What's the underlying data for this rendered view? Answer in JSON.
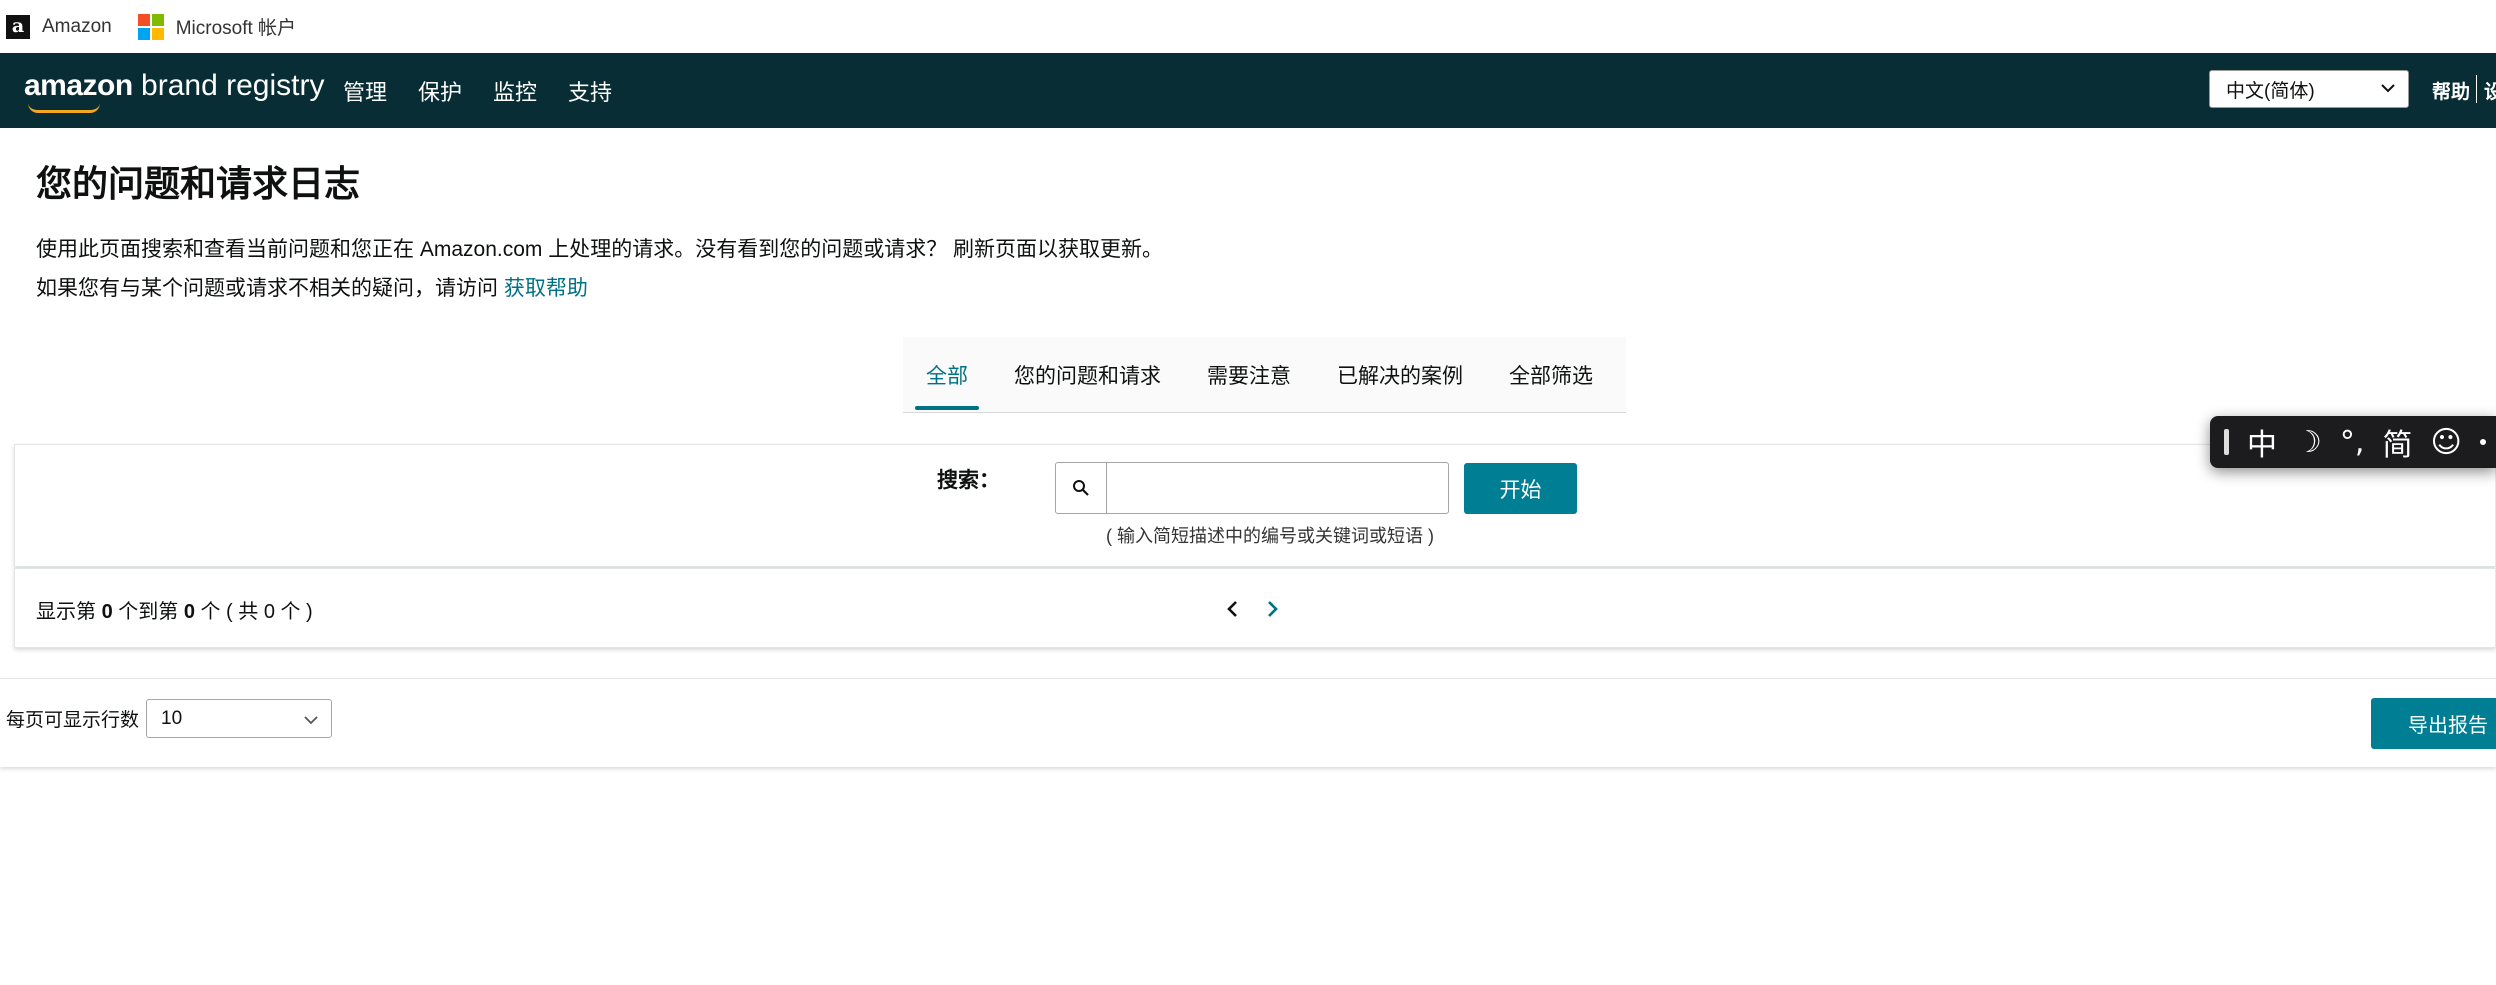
{
  "bookmarks": [
    {
      "label": "Amazon",
      "icon": "amazon-icon"
    },
    {
      "label": "Microsoft 帐户",
      "icon": "microsoft-icon"
    }
  ],
  "nav": {
    "logo_bold": "amazon",
    "logo_rest": " brand registry",
    "items": [
      "管理",
      "保护",
      "监控",
      "支持"
    ],
    "language": "中文(简体)",
    "help": "帮助",
    "settings": "设"
  },
  "page": {
    "title": "您的问题和请求日志",
    "desc1": "使用此页面搜索和查看当前问题和您正在 Amazon.com 上处理的请求。没有看到您的问题或请求？ 刷新页面以获取更新。",
    "desc2": "如果您有与某个问题或请求不相关的疑问，请访问 ",
    "help_link": "获取帮助"
  },
  "tabs": [
    {
      "label": "全部",
      "active": true
    },
    {
      "label": "您的问题和请求",
      "active": false
    },
    {
      "label": "需要注意",
      "active": false
    },
    {
      "label": "已解决的案例",
      "active": false
    },
    {
      "label": "全部筛选",
      "active": false
    }
  ],
  "search": {
    "label": "搜索：",
    "value": "",
    "button": "开始",
    "hint": "( 输入简短描述中的编号或关键词或短语 )"
  },
  "pagination": {
    "prefix": "显示第 ",
    "from": "0",
    "mid": " 个到第 ",
    "to": "0",
    "suffix": " 个 ( 共 0 个 )"
  },
  "footer": {
    "rows_label": "每页可显示行数",
    "rows_value": "10",
    "export": "导出报告"
  },
  "ime": {
    "items": [
      "中",
      "☽",
      "°,",
      "简",
      "☺"
    ]
  },
  "colors": {
    "nav_bg": "#082d34",
    "accent": "#007185",
    "button": "#007e93"
  }
}
